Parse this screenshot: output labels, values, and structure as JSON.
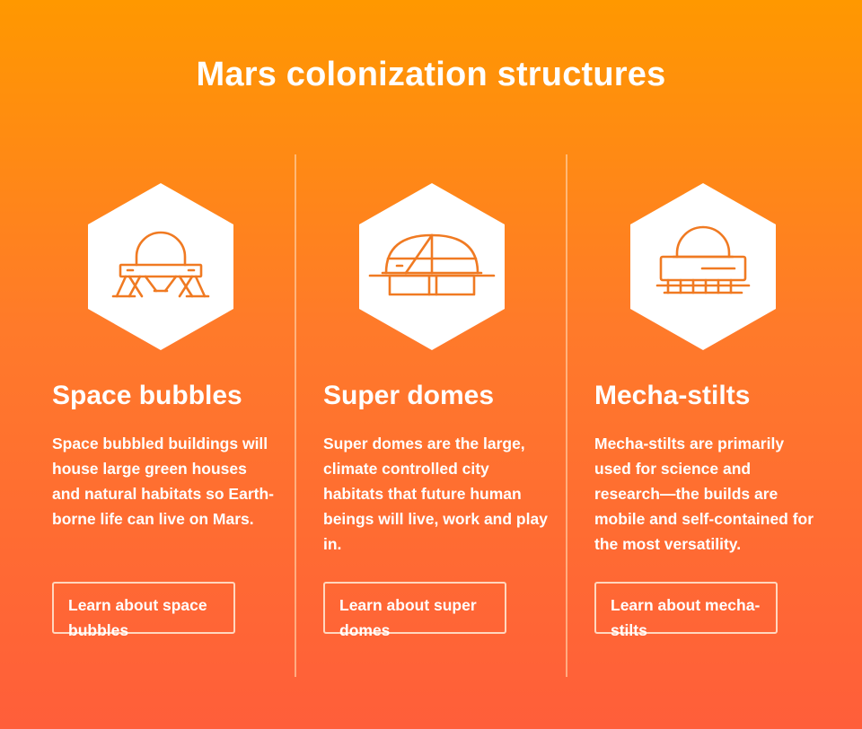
{
  "page": {
    "title": "Mars colonization structures"
  },
  "colors": {
    "gradient_top": "#ff9800",
    "gradient_bottom": "#ff5e3a",
    "icon_stroke": "#f07a22",
    "hex_fill": "#ffffff",
    "text": "#ffffff"
  },
  "cards": [
    {
      "icon": "space-bubble-icon",
      "title": "Space bubbles",
      "body": "Space bubbled buildings will house large green houses and natural habitats so Earth-borne life can live on Mars.",
      "button_label": "Learn about space bubbles"
    },
    {
      "icon": "super-dome-icon",
      "title": "Super domes",
      "body": "Super domes are the large, climate controlled city habitats that future human beings will live, work and play in.",
      "button_label": "Learn about super domes"
    },
    {
      "icon": "mecha-stilt-icon",
      "title": "Mecha-stilts",
      "body": "Mecha-stilts are primarily used for science and research—the builds are mobile and self-contained for the most versatility.",
      "button_label": "Learn about mecha-stilts"
    }
  ]
}
